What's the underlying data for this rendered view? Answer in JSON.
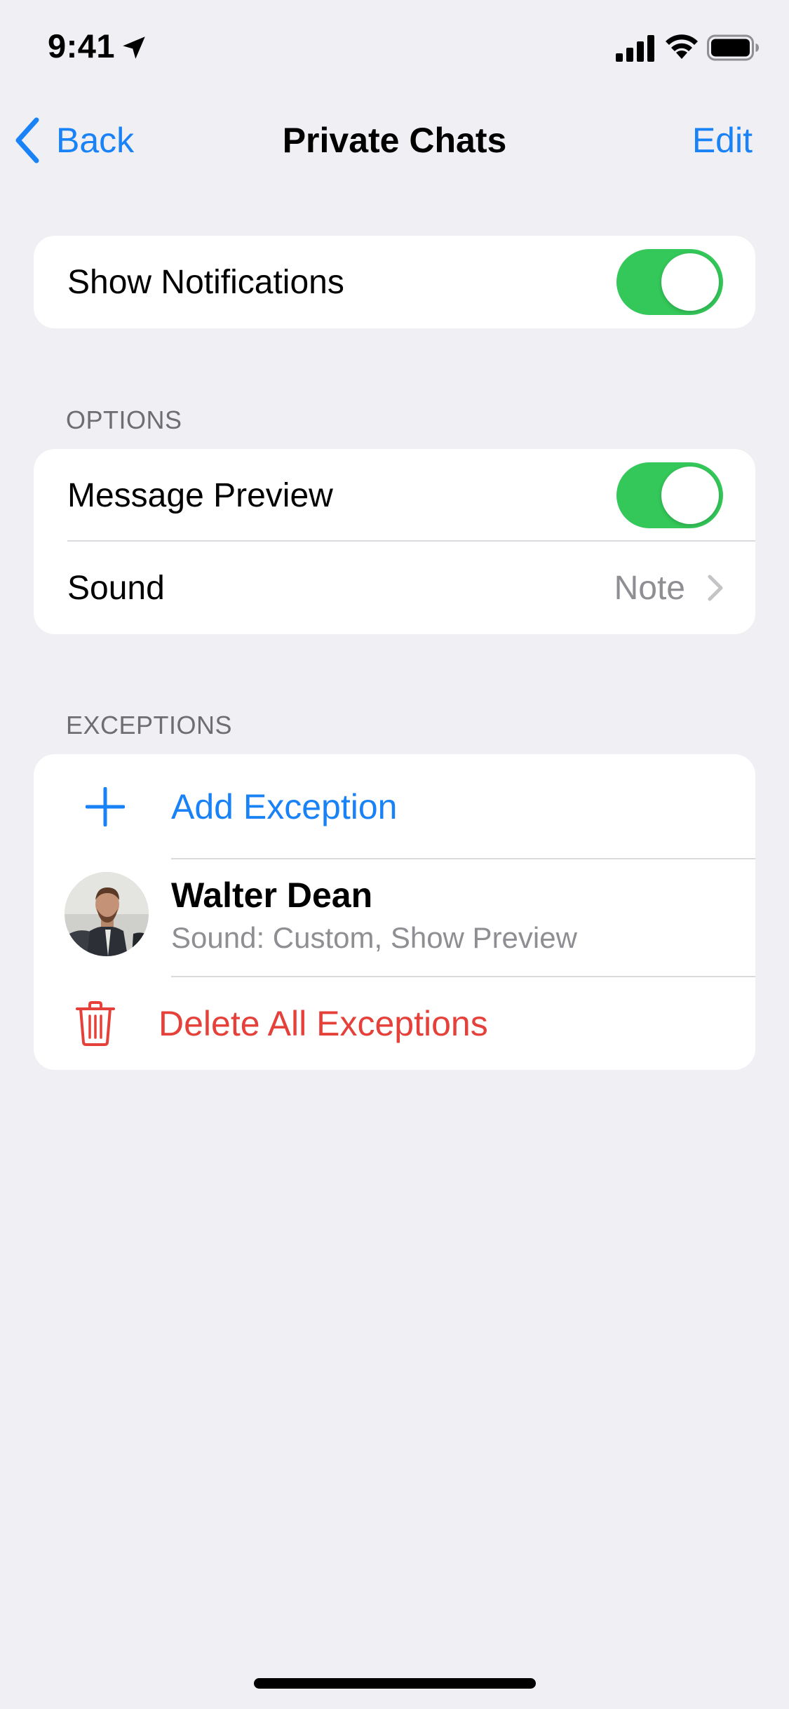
{
  "status_bar": {
    "time": "9:41"
  },
  "nav": {
    "back_label": "Back",
    "title": "Private Chats",
    "edit_label": "Edit"
  },
  "notifications": {
    "label": "Show Notifications",
    "enabled": true
  },
  "options": {
    "header": "OPTIONS",
    "message_preview": {
      "label": "Message Preview",
      "enabled": true
    },
    "sound": {
      "label": "Sound",
      "value": "Note"
    }
  },
  "exceptions": {
    "header": "EXCEPTIONS",
    "add_label": "Add Exception",
    "items": [
      {
        "name": "Walter Dean",
        "detail": "Sound: Custom, Show Preview"
      }
    ],
    "delete_label": "Delete All Exceptions"
  },
  "colors": {
    "accent": "#1a82f7",
    "toggle_on": "#34c759",
    "destructive": "#e5403a",
    "background": "#efeff4"
  },
  "icons": [
    "location-arrow-icon",
    "signal-icon",
    "wifi-icon",
    "battery-icon",
    "chevron-left-icon",
    "chevron-right-icon",
    "plus-icon",
    "trash-icon"
  ]
}
